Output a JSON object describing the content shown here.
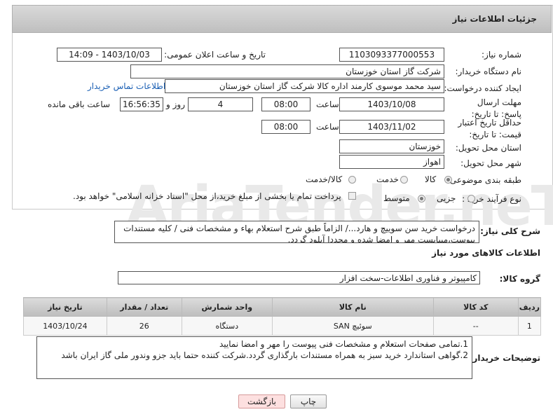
{
  "header": {
    "title": "جزئیات اطلاعات نیاز"
  },
  "watermark": "AriaTender.neT",
  "fields": {
    "need_number_label": "شماره نیاز:",
    "need_number": "1103093377000553",
    "announce_label": "تاریخ و ساعت اعلان عمومی:",
    "announce_value": "1403/10/03 - 14:09",
    "buyer_org_label": "نام دستگاه خریدار:",
    "buyer_org": "شرکت گاز استان خوزستان",
    "requester_label": "ایجاد کننده درخواست:",
    "requester": "سید محمد موسوی کارمند اداره کالا شرکت گاز استان خوزستان",
    "contact_link": "اطلاعات تماس خریدار",
    "deadline_label": "مهلت ارسال پاسخ: تا تاریخ:",
    "deadline_date": "1403/10/08",
    "time_label": "ساعت",
    "deadline_time": "08:00",
    "days": "4",
    "days_label": "روز و",
    "remaining_time": "16:56:35",
    "remaining_label": "ساعت باقی مانده",
    "validity_label": "حداقل تاریخ اعتبار قیمت: تا تاریخ:",
    "validity_date": "1403/11/02",
    "validity_time": "08:00",
    "province_label": "استان محل تحویل:",
    "province": "خوزستان",
    "city_label": "شهر محل تحویل:",
    "city": "اهواز",
    "category_label": "طبقه بندی موضوعی:",
    "category_options": [
      "کالا",
      "خدمت",
      "کالا/خدمت"
    ],
    "category_selected": "کالا",
    "process_label": "نوع فرآیند خرید :",
    "process_options": [
      "جزیی",
      "متوسط"
    ],
    "process_selected": "متوسط",
    "payment_note": "پرداخت تمام یا بخشی از مبلغ خرید،از محل \"اسناد خزانه اسلامی\" خواهد بود."
  },
  "description": {
    "label": "شرح کلی نیاز:",
    "text": "درخواست خرید سن سوییچ و هارد.../ الزاماً طبق شرح استعلام بهاء و مشخصات فنی / کلیه مستندات پیوست،میبایست مهر و امضا شده و مجددا آپلود گردد."
  },
  "goods_section": {
    "title": "اطلاعات کالاهای مورد نیاز",
    "group_label": "گروه کالا:",
    "group_value": "کامپیوتر و فناوری اطلاعات-سخت افزار"
  },
  "table": {
    "headers": [
      "ردیف",
      "کد کالا",
      "نام کالا",
      "واحد شمارش",
      "تعداد / مقدار",
      "تاریخ نیاز"
    ],
    "rows": [
      [
        "1",
        "--",
        "سوئیچ SAN",
        "دستگاه",
        "26",
        "1403/10/24"
      ]
    ]
  },
  "buyer_notes": {
    "label": "توضیحات خریدار:",
    "line1": "1.تمامی صفحات استعلام و مشخصات فنی پیوست را مهر و امضا نمایید",
    "line2": "2.گواهی استاندارد خرید سبز به همراه مستندات بارگذاری گردد.شرکت کننده حتما باید جزو وندور ملی گاز ایران باشد"
  },
  "buttons": {
    "print": "چاپ",
    "back": "بازگشت"
  }
}
